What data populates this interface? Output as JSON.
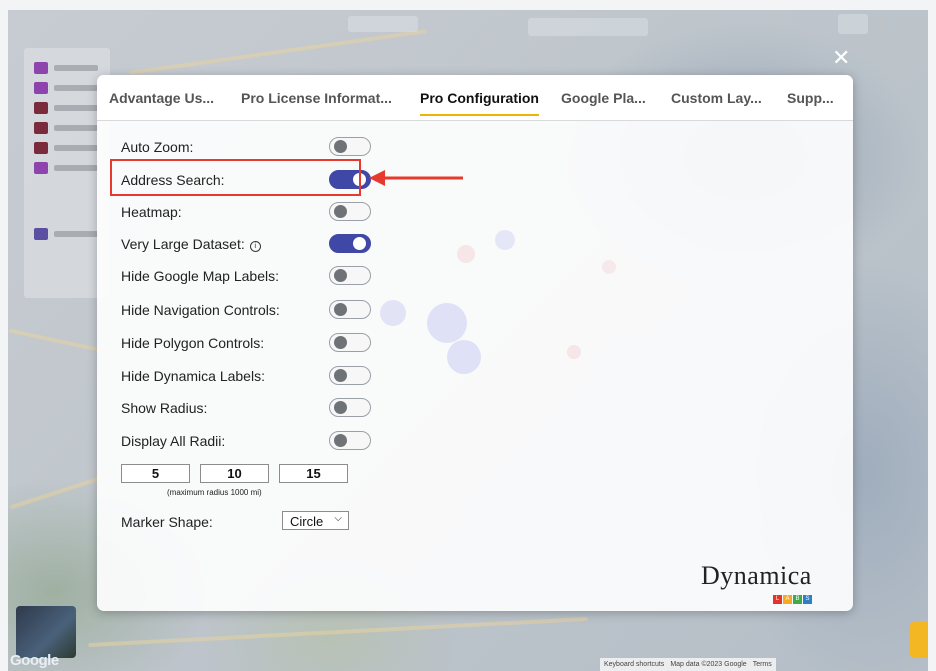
{
  "window": {
    "close_glyph": "✕"
  },
  "tabs": [
    {
      "label": "Advantage Us...",
      "active": false
    },
    {
      "label": "Pro License Informat...",
      "active": false
    },
    {
      "label": "Pro Configuration",
      "active": true
    },
    {
      "label": "Google Pla...",
      "active": false
    },
    {
      "label": "Custom Lay...",
      "active": false
    },
    {
      "label": "Supp...",
      "active": false
    }
  ],
  "settings": [
    {
      "label": "Auto Zoom:",
      "on": false
    },
    {
      "label": "Address Search:",
      "on": true
    },
    {
      "label": "Heatmap:",
      "on": false
    },
    {
      "label": "Very Large Dataset:",
      "on": true
    },
    {
      "label": "Hide Google Map Labels:",
      "on": false
    },
    {
      "label": "Hide Navigation Controls:",
      "on": false
    },
    {
      "label": "Hide Polygon Controls:",
      "on": false
    },
    {
      "label": "Hide Dynamica Labels:",
      "on": false
    },
    {
      "label": "Show Radius:",
      "on": false
    },
    {
      "label": "Display All Radii:",
      "on": false
    }
  ],
  "radius": {
    "values": [
      "5",
      "10",
      "15"
    ],
    "note": "(maximum radius 1000 mi)"
  },
  "marker_shape": {
    "label": "Marker Shape:",
    "selected": "Circle"
  },
  "brand": {
    "name": "Dynamica",
    "sublabel": "LABS",
    "colors": [
      "#e8332a",
      "#f7a823",
      "#41a94a",
      "#2e7fc3"
    ]
  },
  "map": {
    "footer": [
      "Keyboard shortcuts",
      "Map data ©2023 Google",
      "Terms"
    ],
    "google_logo": "Google"
  },
  "colors": {
    "toggle_on": "#3f48a6",
    "tab_underline": "#f0b400",
    "highlight": "#e63a2e"
  }
}
